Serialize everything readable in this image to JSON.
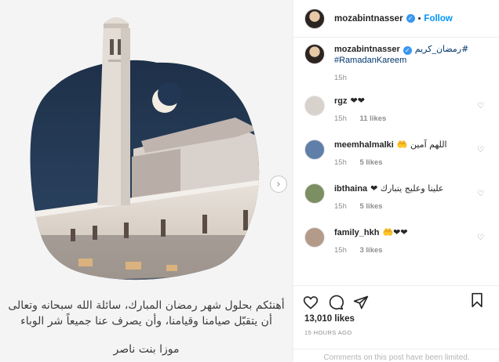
{
  "post": {
    "caption_line_1": "أهنئكم بحلول شهر رمضان المبارك، سائلة الله سبحانه وتعالى",
    "caption_line_2": "أن يتقبّل صيامنا وقيامنا، وأن يصرف عنا جميعاً شر الوباء",
    "signature": "موزا بنت ناصر",
    "next_arrow": "›"
  },
  "header": {
    "username": "mozabintnasser",
    "verified_glyph": "✓",
    "separator": "•",
    "follow_label": "Follow"
  },
  "caption": {
    "username": "mozabintnasser",
    "text": "#رمضان_كريم",
    "hashtag": "#RamadanKareem",
    "time": "15h"
  },
  "comments": [
    {
      "username": "rgz",
      "text": "❤❤",
      "time": "15h",
      "likes": "11 likes",
      "avatar_color": "#d8d2cc"
    },
    {
      "username": "meemhalmalki",
      "text": "اللهم آمين 🤲",
      "time": "15h",
      "likes": "5 likes",
      "avatar_color": "#5f7fa8"
    },
    {
      "username": "ibthaina",
      "text": "علينا وعليج يتبارك ❤",
      "time": "15h",
      "likes": "5 likes",
      "avatar_color": "#7c8f63"
    },
    {
      "username": "family_hkh",
      "text": "❤❤🤲",
      "time": "15h",
      "likes": "3 likes",
      "avatar_color": "#b49a88"
    }
  ],
  "comment_heart": "♡",
  "footer": {
    "like_count": "13,010 likes",
    "date": "15 HOURS AGO",
    "limited": "Comments on this post have been limited."
  }
}
